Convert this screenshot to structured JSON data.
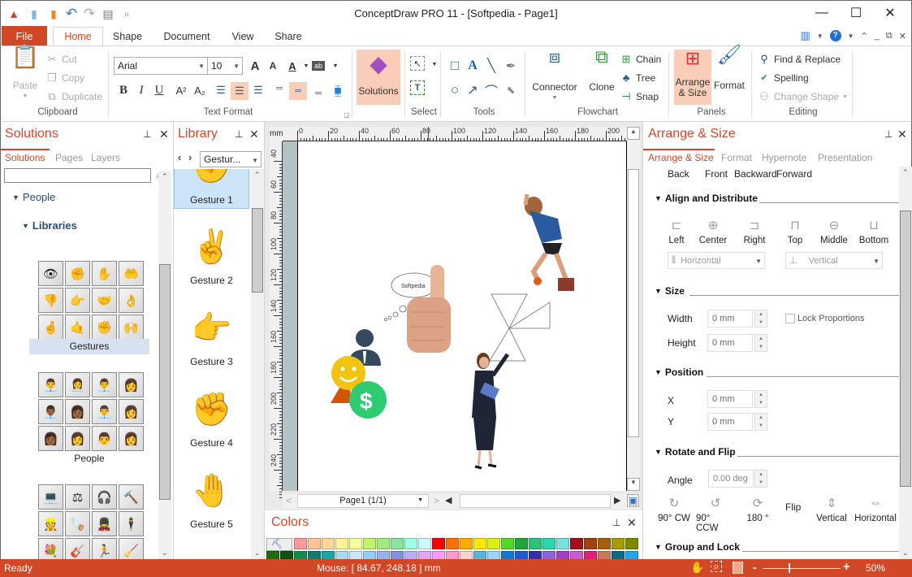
{
  "window": {
    "title": "ConceptDraw PRO 11 - [Softpedia - Page1]",
    "controls": {
      "minimize": "—",
      "maximize": "☐",
      "close": "✕"
    }
  },
  "quick_access": [
    {
      "name": "app-logo-icon",
      "glyph": "▲"
    },
    {
      "name": "new-document-icon",
      "glyph": "▮"
    },
    {
      "name": "open-folder-icon",
      "glyph": "▮"
    },
    {
      "name": "undo-icon",
      "glyph": "↶"
    },
    {
      "name": "redo-icon",
      "glyph": "↷"
    },
    {
      "name": "save-icon",
      "glyph": "▤"
    },
    {
      "name": "preview-icon",
      "glyph": "🔍"
    }
  ],
  "ribbon_tabs": {
    "file": "File",
    "tabs": [
      {
        "label": "Home",
        "active": true
      },
      {
        "label": "Shape",
        "active": false
      },
      {
        "label": "Document",
        "active": false
      },
      {
        "label": "View",
        "active": false
      },
      {
        "label": "Share",
        "active": false
      }
    ]
  },
  "ribbon": {
    "clipboard": {
      "label": "Clipboard",
      "paste": "Paste",
      "cut": "Cut",
      "copy": "Copy",
      "duplicate": "Duplicate"
    },
    "text_format": {
      "label": "Text Format",
      "font": "Arial",
      "size": "10",
      "bold": "B",
      "italic": "I",
      "underline": "U",
      "superscript": "A²",
      "subscript": "A₂"
    },
    "solutions": {
      "label": "Solutions"
    },
    "select": {
      "label": "Select"
    },
    "tools": {
      "label": "Tools"
    },
    "flowchart": {
      "label": "Flowchart",
      "connector": "Connector",
      "clone": "Clone",
      "chain": "Chain",
      "tree": "Tree",
      "snap": "Snap"
    },
    "panels": {
      "label": "Panels",
      "arrange_size": "Arrange & Size",
      "format": "Format"
    },
    "editing": {
      "label": "Editing",
      "find_replace": "Find & Replace",
      "spelling": "Spelling",
      "change_shape": "Change Shape"
    }
  },
  "solutions_panel": {
    "title": "Solutions",
    "tabs": [
      "Solutions",
      "Pages",
      "Layers"
    ],
    "search_placeholder": "",
    "tree": {
      "people": "People",
      "libraries": "Libraries"
    },
    "libraries": [
      {
        "label": "Gestures",
        "selected": true,
        "glyphs": [
          "👁",
          "✊",
          "✋",
          "🤲",
          "👎",
          "👉",
          "🤝",
          "👌",
          "🤞",
          "🤙",
          "✊",
          "🙌"
        ]
      },
      {
        "label": "People",
        "selected": false,
        "glyphs": [
          "👨‍💼",
          "👩‍💼",
          "👨‍💼",
          "👩",
          "👨🏾‍💼",
          "👩🏾",
          "👨‍💼",
          "👩",
          "👩🏾",
          "👩",
          "👨",
          "👩"
        ]
      },
      {
        "label": "",
        "selected": false,
        "glyphs": [
          "💻",
          "⚖",
          "🎧",
          "🔨",
          "👷",
          "🪚",
          "💂",
          "🕴",
          "💐",
          "🎸",
          "🏃",
          "🧹"
        ]
      }
    ]
  },
  "library_panel": {
    "title": "Library",
    "selector": "Gestur...",
    "items": [
      {
        "label": "Gesture 1",
        "glyph": "✊",
        "selected": true
      },
      {
        "label": "Gesture 2",
        "glyph": "✌",
        "selected": false
      },
      {
        "label": "Gesture 3",
        "glyph": "👉",
        "selected": false
      },
      {
        "label": "Gesture 4",
        "glyph": "✊",
        "selected": false
      },
      {
        "label": "Gesture 5",
        "glyph": "🤚",
        "selected": false
      }
    ]
  },
  "canvas": {
    "ruler_unit": "mm",
    "h_ticks": [
      "0",
      "20",
      "40",
      "60",
      "80",
      "100",
      "120",
      "140",
      "160",
      "180",
      "200"
    ],
    "v_ticks": [
      "40",
      "60",
      "80",
      "100",
      "120",
      "140",
      "160",
      "180",
      "200",
      "220",
      "240"
    ],
    "cloud_text": "Softpedia",
    "page_selector": "Page1 (1/1)"
  },
  "colors_panel": {
    "title": "Colors",
    "row1": [
      "#ff9999",
      "#ffc499",
      "#ffd999",
      "#fff299",
      "#f2ff99",
      "#c4f266",
      "#a1ec7e",
      "#8ce39e",
      "#9cffe3",
      "#c9fbff",
      "#ff0000",
      "#ff7200",
      "#ffae00",
      "#ffe800",
      "#d7f00f",
      "#51d92a",
      "#1fa63a",
      "#2bc37c",
      "#2bd6b0",
      "#7ae0e0",
      "#a3101c",
      "#a0420f",
      "#a65f0a",
      "#a69b00",
      "#7b8a00"
    ],
    "row2": [
      "#1b6e10",
      "#0d5210",
      "#0f8c4a",
      "#0f7d70",
      "#15a6a6",
      "#a6dced",
      "#c9e8ff",
      "#92ccff",
      "#95b3ea",
      "#7e91e3",
      "#b8b0ff",
      "#dfa6f2",
      "#ff99ff",
      "#ff99cc",
      "#f6d6cc",
      "#5bb3d6",
      "#97d6ff",
      "#0f7ad6",
      "#1f59d9",
      "#3131b0",
      "#8f63e0",
      "#a040c9",
      "#c65ccf",
      "#e0207a",
      "#c47a5c",
      "#0b6a8a",
      "#1ea6f0"
    ]
  },
  "arrange_panel": {
    "title": "Arrange & Size",
    "tabs": [
      "Arrange & Size",
      "Format",
      "Hypernote",
      "Presentation"
    ],
    "order": [
      "Back",
      "Front",
      "Backward",
      "Forward"
    ],
    "align": {
      "header": "Align and Distribute",
      "buttons": [
        "Left",
        "Center",
        "Right",
        "Top",
        "Middle",
        "Bottom"
      ],
      "horizontal": "Horizontal",
      "vertical": "Vertical"
    },
    "size": {
      "header": "Size",
      "width_label": "Width",
      "width": "0 mm",
      "height_label": "Height",
      "height": "0 mm",
      "lock": "Lock Proportions"
    },
    "position": {
      "header": "Position",
      "x_label": "X",
      "x": "0 mm",
      "y_label": "Y",
      "y": "0 mm"
    },
    "rotate": {
      "header": "Rotate and Flip",
      "angle_label": "Angle",
      "angle": "0.00 deg",
      "buttons": [
        "90° CW",
        "90° CCW",
        "180 °"
      ],
      "flip": "Flip",
      "flip_buttons": [
        "Vertical",
        "Horizontal"
      ]
    },
    "group": {
      "header": "Group and Lock"
    }
  },
  "statusbar": {
    "status": "Ready",
    "mouse": "Mouse: [ 84.67, 248.18 ] mm",
    "zoom": "50%",
    "zoom_fraction": 0.33
  },
  "accent_color": "#d24726"
}
